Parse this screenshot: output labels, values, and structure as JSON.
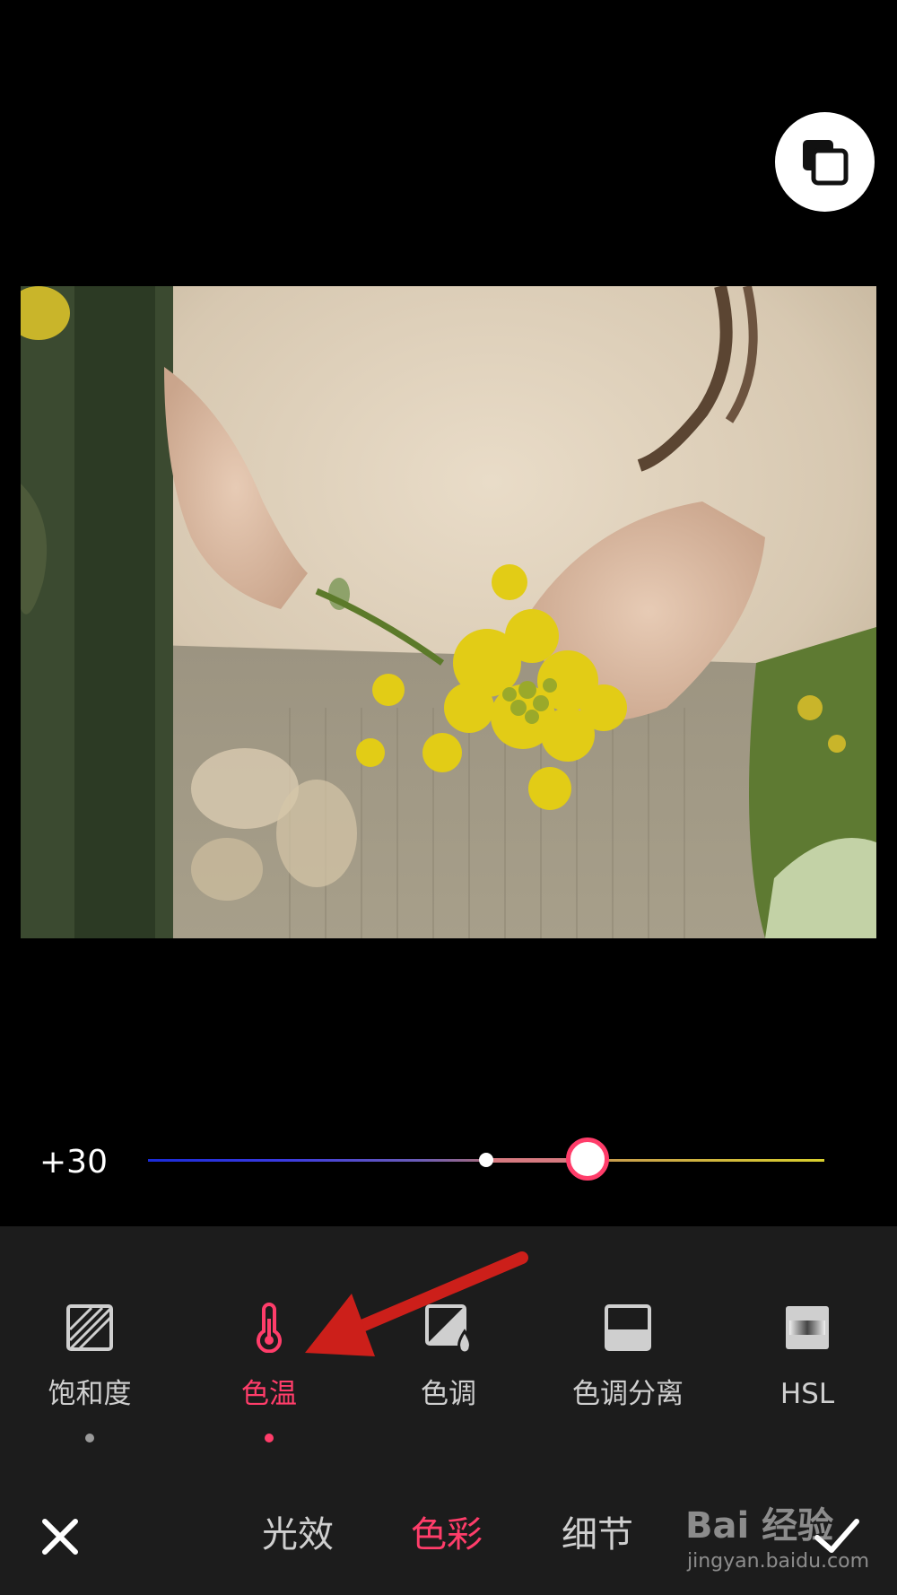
{
  "slider": {
    "value_label": "+30",
    "position": 0.65,
    "center": 0.5
  },
  "tools": [
    {
      "label": "饱和度",
      "icon": "saturation-icon",
      "active": false,
      "dot": true
    },
    {
      "label": "色温",
      "icon": "thermometer-icon",
      "active": true,
      "dot": true
    },
    {
      "label": "色调",
      "icon": "tint-icon",
      "active": false,
      "dot": false
    },
    {
      "label": "色调分离",
      "icon": "split-tone-icon",
      "active": false,
      "dot": false
    },
    {
      "label": "HSL",
      "icon": "hsl-icon",
      "active": false,
      "dot": false
    }
  ],
  "tabs": [
    {
      "label": "光效",
      "active": false
    },
    {
      "label": "色彩",
      "active": true
    },
    {
      "label": "细节",
      "active": false
    }
  ],
  "colors": {
    "accent": "#ff3d6a",
    "panel": "#1c1c1c",
    "text": "#cfcfcf",
    "arrow": "#cc1f1a"
  },
  "watermark": {
    "logo": "Bai 经验",
    "url": "jingyan.baidu.com"
  }
}
